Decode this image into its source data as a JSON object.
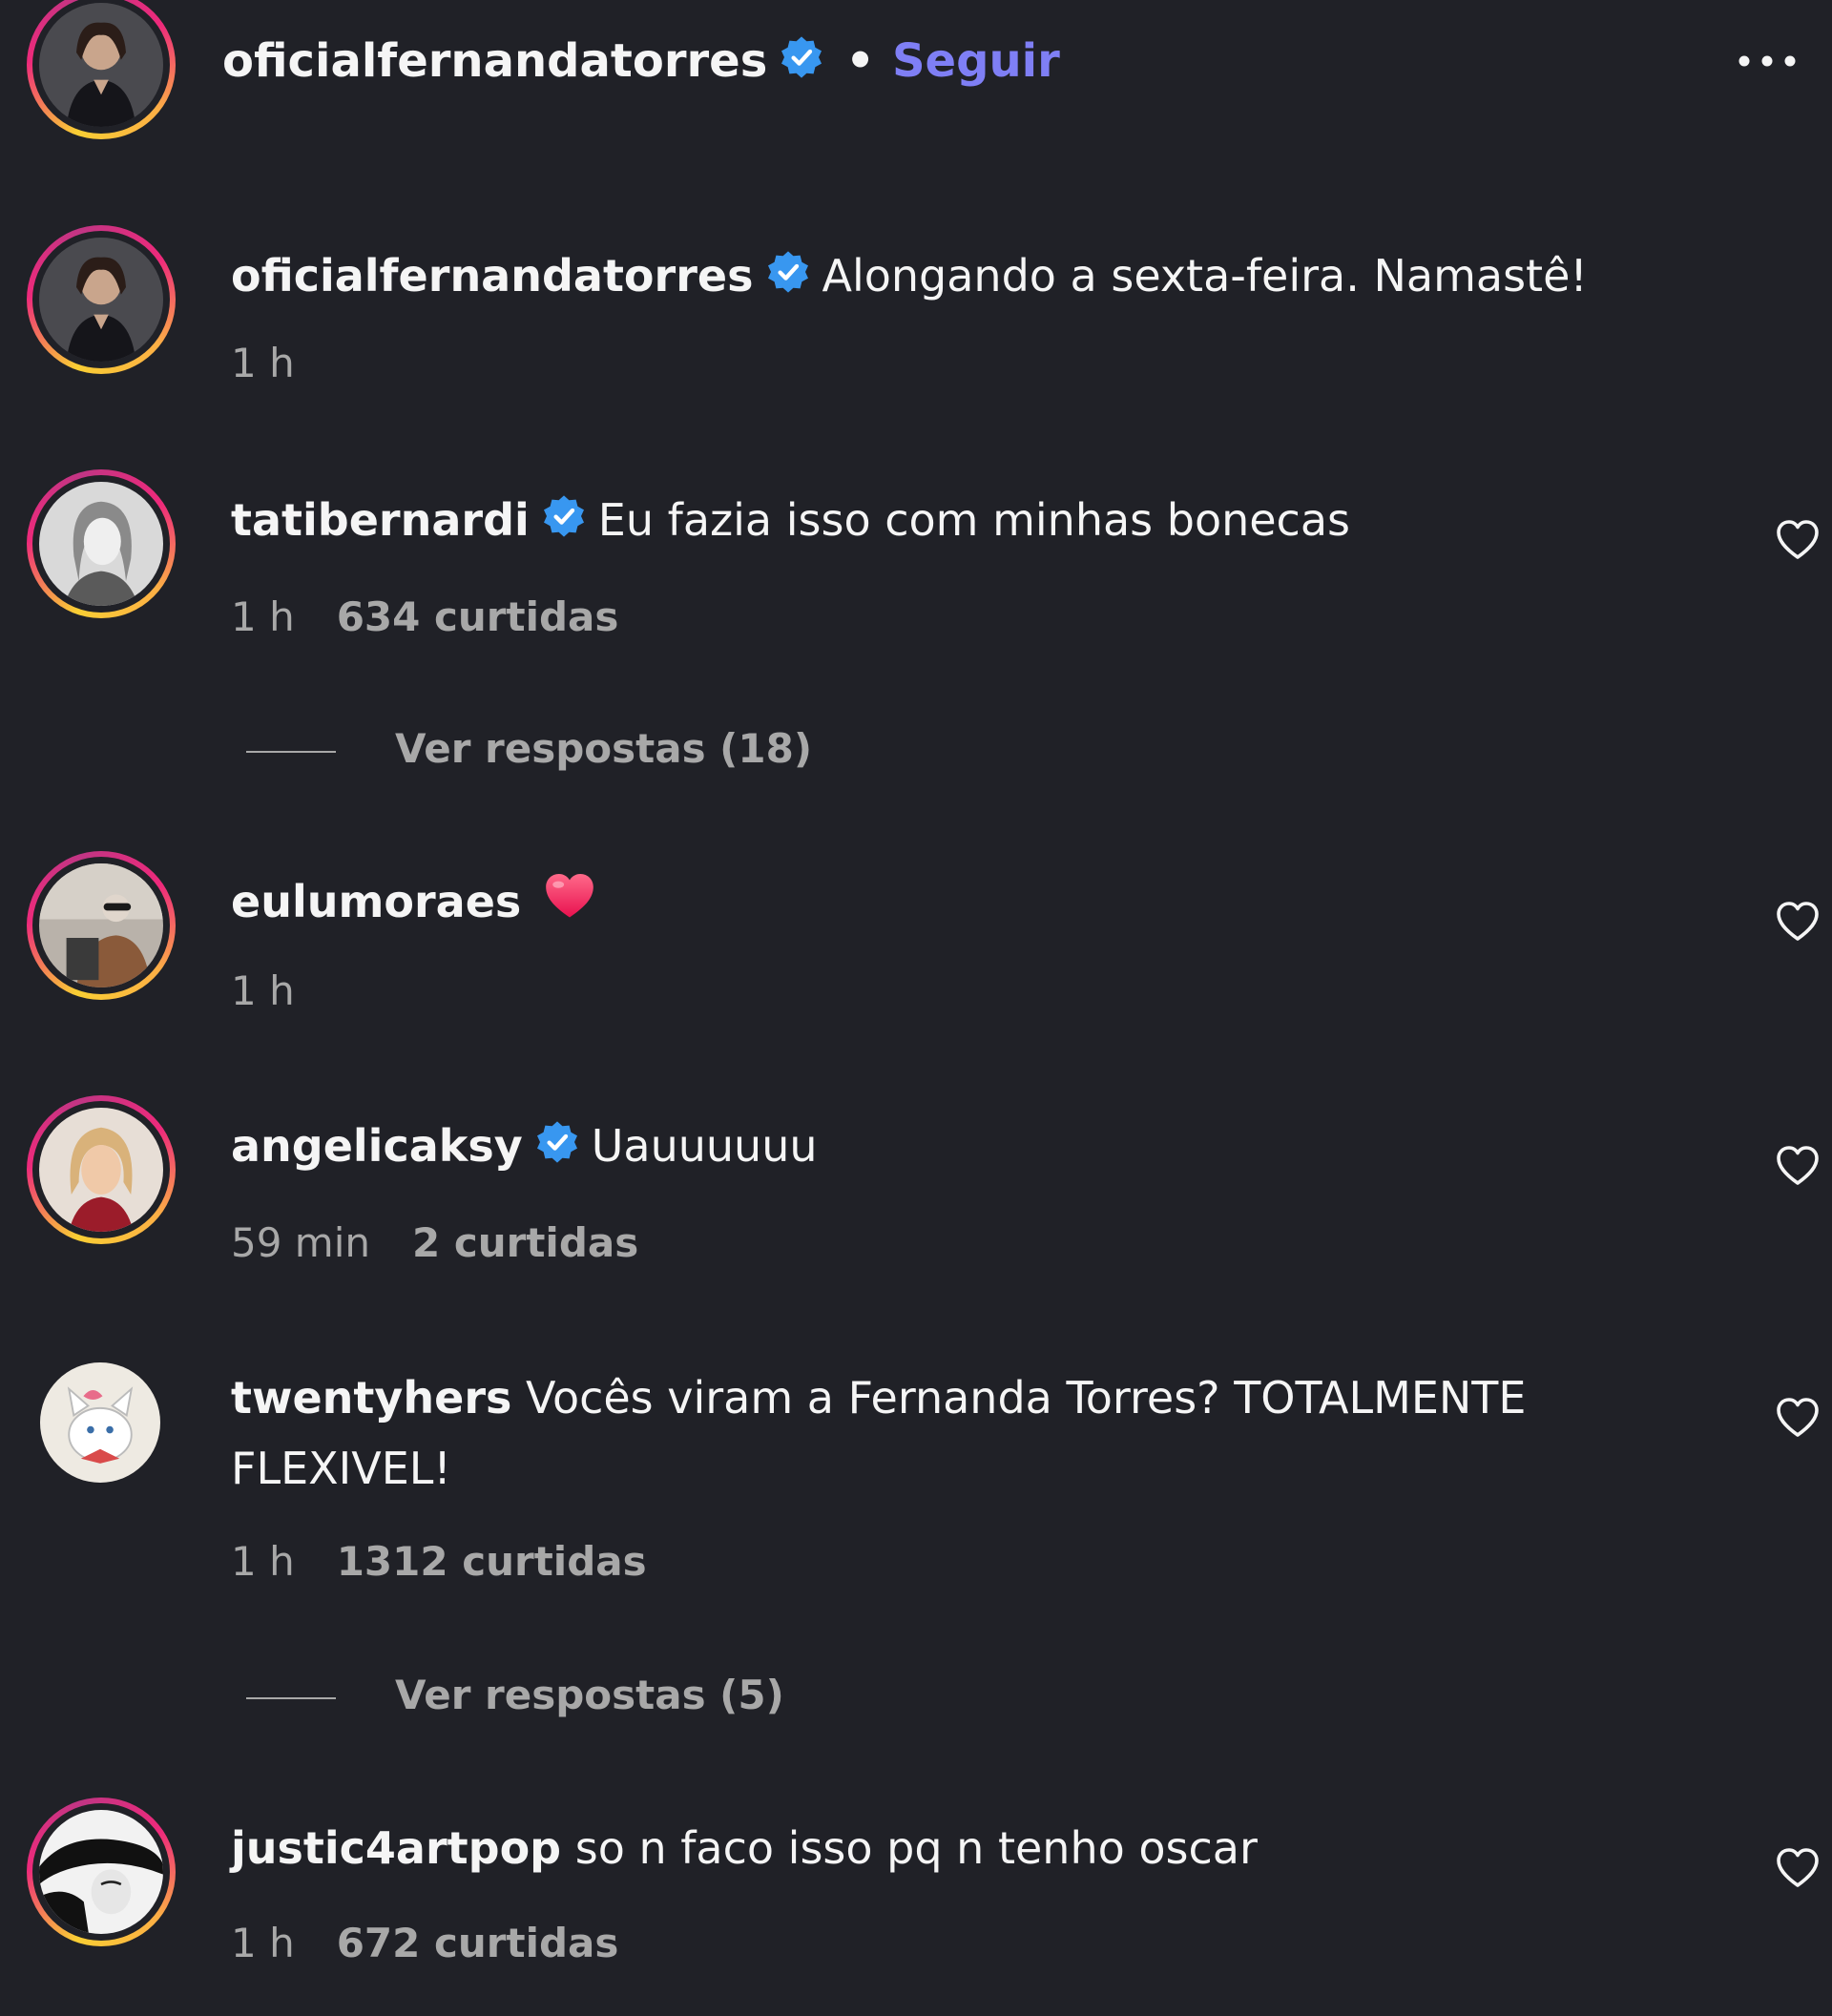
{
  "post": {
    "author": "oficialfernandatorres",
    "separator": "•",
    "follow_label": "Seguir",
    "caption": "Alongando a sexta-feira. Namastê!",
    "caption_time": "1 h"
  },
  "replies_label_1": "Ver respostas (18)",
  "replies_label_2": "Ver respostas (5)",
  "comments": [
    {
      "user": "tatibernardi",
      "verified": true,
      "text": "Eu fazia isso com minhas bonecas",
      "time": "1 h",
      "likes": "634 curtidas"
    },
    {
      "user": "eulumoraes",
      "verified": false,
      "text": "",
      "emoji": "red-heart",
      "time": "1 h",
      "likes": ""
    },
    {
      "user": "angelicaksy",
      "verified": true,
      "text": "Uauuuuuu",
      "time": "59 min",
      "likes": "2 curtidas"
    },
    {
      "user": "twentyhers",
      "verified": false,
      "text": "Vocês viram a Fernanda Torres? TOTALMENTE FLEXIVEL!",
      "time": "1 h",
      "likes": "1312 curtidas"
    },
    {
      "user": "justic4artpop",
      "verified": false,
      "text": "so n faco isso pq n tenho oscar",
      "time": "1 h",
      "likes": "672 curtidas"
    }
  ],
  "icons": {
    "verified": "verified-badge-icon",
    "like": "heart-outline-icon",
    "more": "more-options-icon"
  },
  "colors": {
    "background": "#202127",
    "follow": "#7f7ff5",
    "verified": "#3897f0",
    "muted": "#a8a8a8"
  }
}
